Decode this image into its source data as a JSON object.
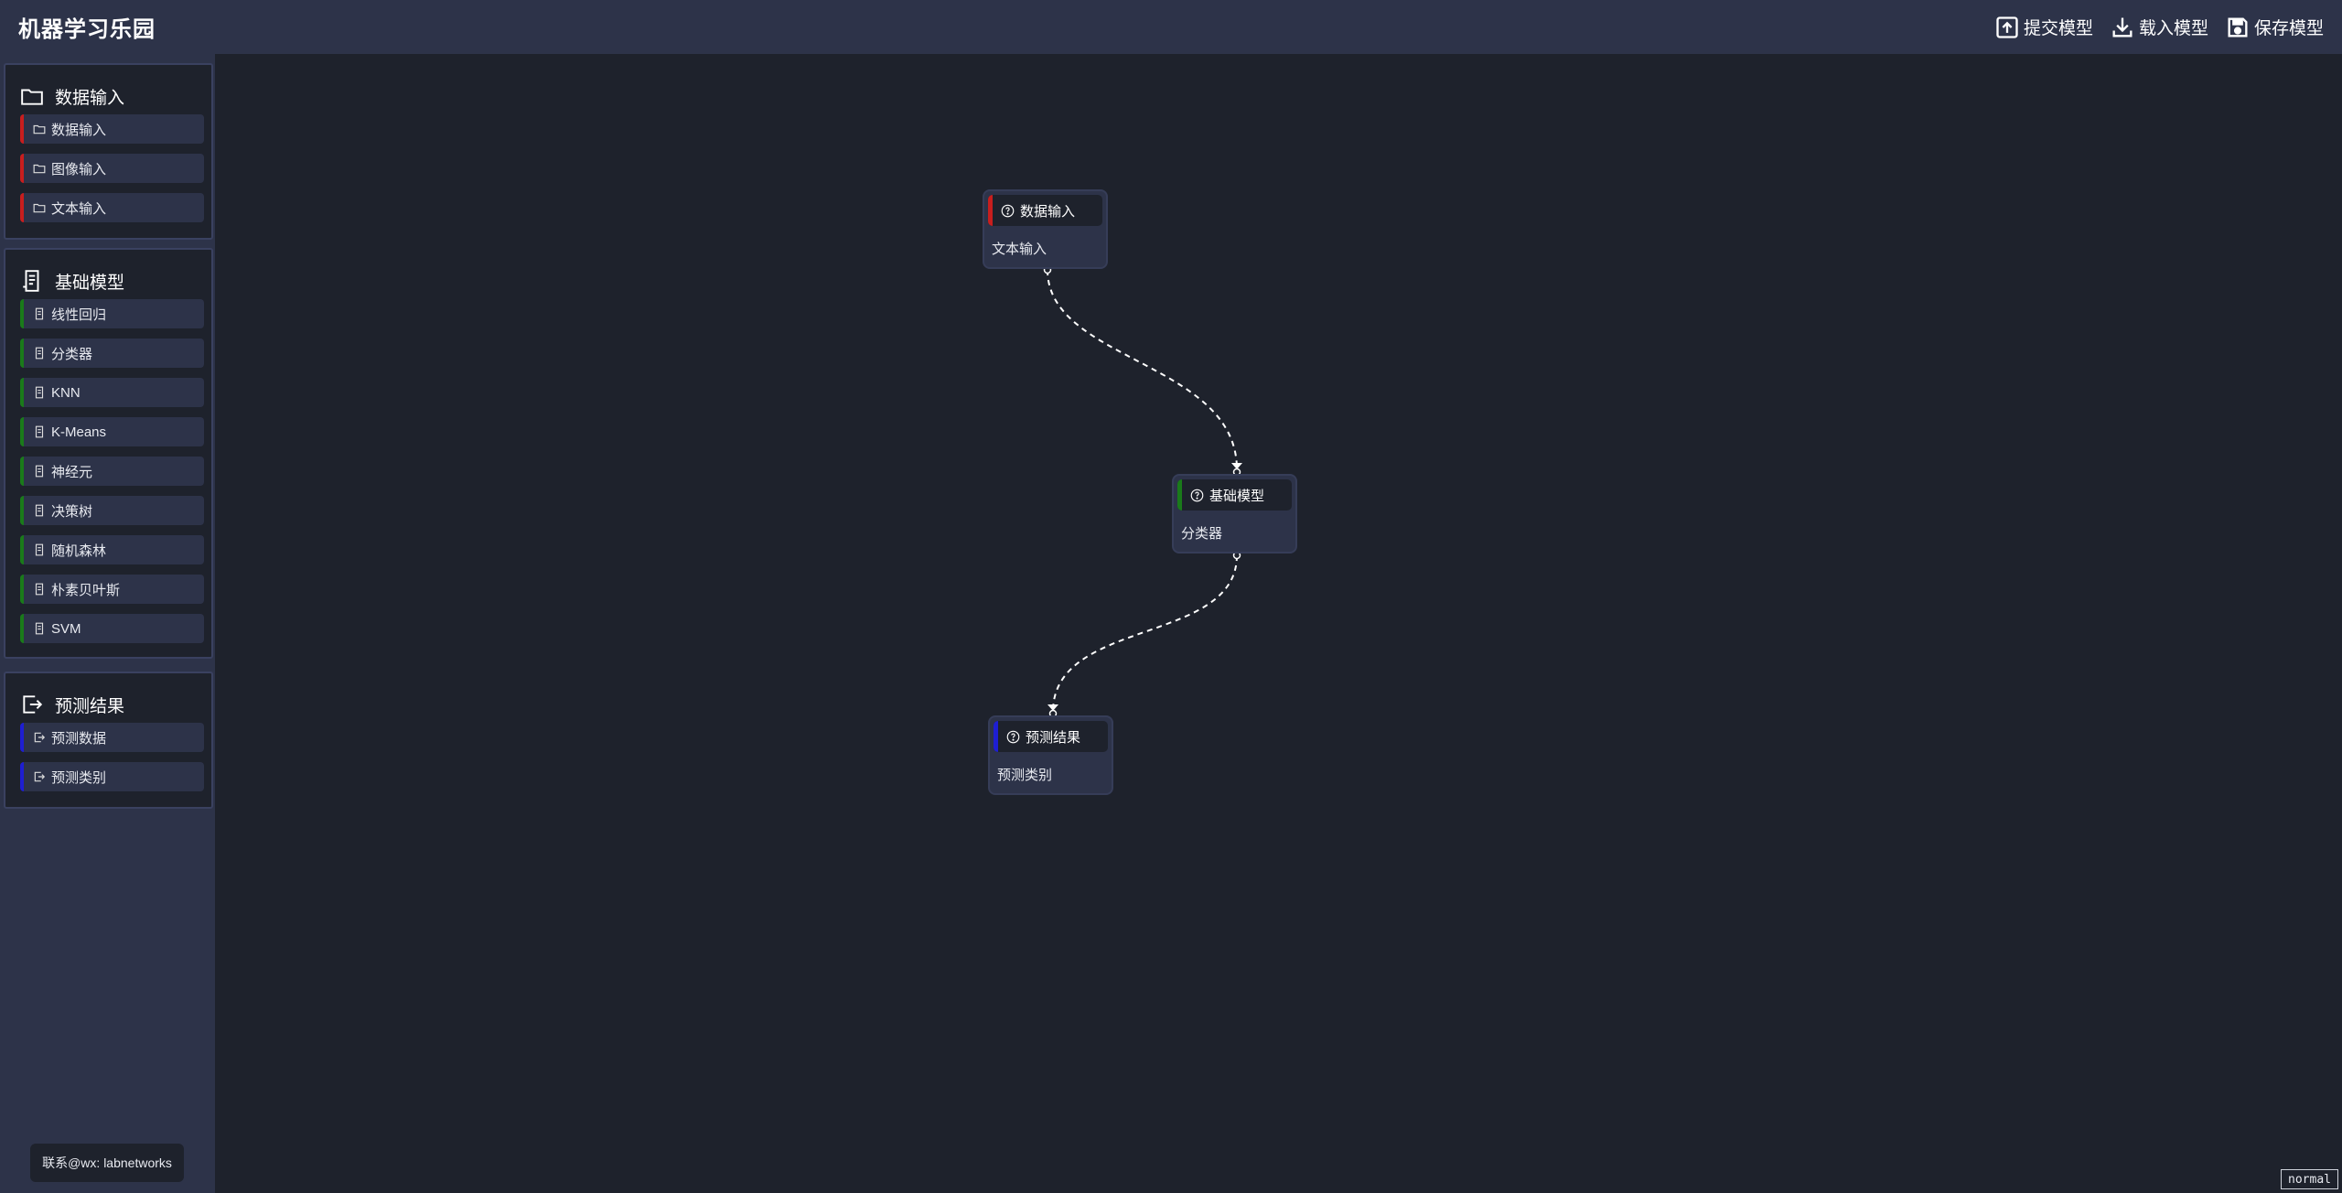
{
  "header": {
    "title": "机器学习乐园",
    "buttons": {
      "submit": "提交模型",
      "load": "载入模型",
      "save": "保存模型"
    }
  },
  "sidebar": {
    "groups": [
      {
        "title": "数据输入",
        "icon": "folder-icon",
        "accent": "#c81e1e",
        "items": [
          "数据输入",
          "图像输入",
          "文本输入"
        ]
      },
      {
        "title": "基础模型",
        "icon": "document-icon",
        "accent": "#1a7a1a",
        "items": [
          "线性回归",
          "分类器",
          "KNN",
          "K-Means",
          "神经元",
          "决策树",
          "随机森林",
          "朴素贝叶斯",
          "SVM"
        ]
      },
      {
        "title": "预测结果",
        "icon": "export-icon",
        "accent": "#1e1ed2",
        "items": [
          "预测数据",
          "预测类别"
        ]
      }
    ],
    "contact": "联系@wx: labnetworks"
  },
  "canvas": {
    "nodes": [
      {
        "id": "n1",
        "category": "数据输入",
        "label": "文本输入",
        "accent": "#c81e1e"
      },
      {
        "id": "n2",
        "category": "基础模型",
        "label": "分类器",
        "accent": "#1a7a1a"
      },
      {
        "id": "n3",
        "category": "预测结果",
        "label": "预测类别",
        "accent": "#1e1ed2"
      }
    ],
    "edges": [
      {
        "from": "n1",
        "to": "n2"
      },
      {
        "from": "n2",
        "to": "n3"
      }
    ]
  },
  "status": {
    "mode": "normal"
  }
}
